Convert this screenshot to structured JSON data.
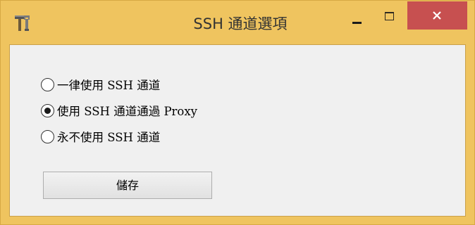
{
  "window": {
    "title": "SSH 通道選項",
    "app_icon": "tools-icon",
    "controls": {
      "minimize_icon": "minimize-icon",
      "maximize_icon": "maximize-icon",
      "close_icon": "close-icon",
      "close_color": "#c75050"
    },
    "frame_color": "#efc45f"
  },
  "options": [
    {
      "label": "一律使用 SSH 通道",
      "selected": false
    },
    {
      "label": "使用 SSH 通道通過 Proxy",
      "selected": true
    },
    {
      "label": "永不使用 SSH 通道",
      "selected": false
    }
  ],
  "save_button": {
    "label": "儲存"
  }
}
